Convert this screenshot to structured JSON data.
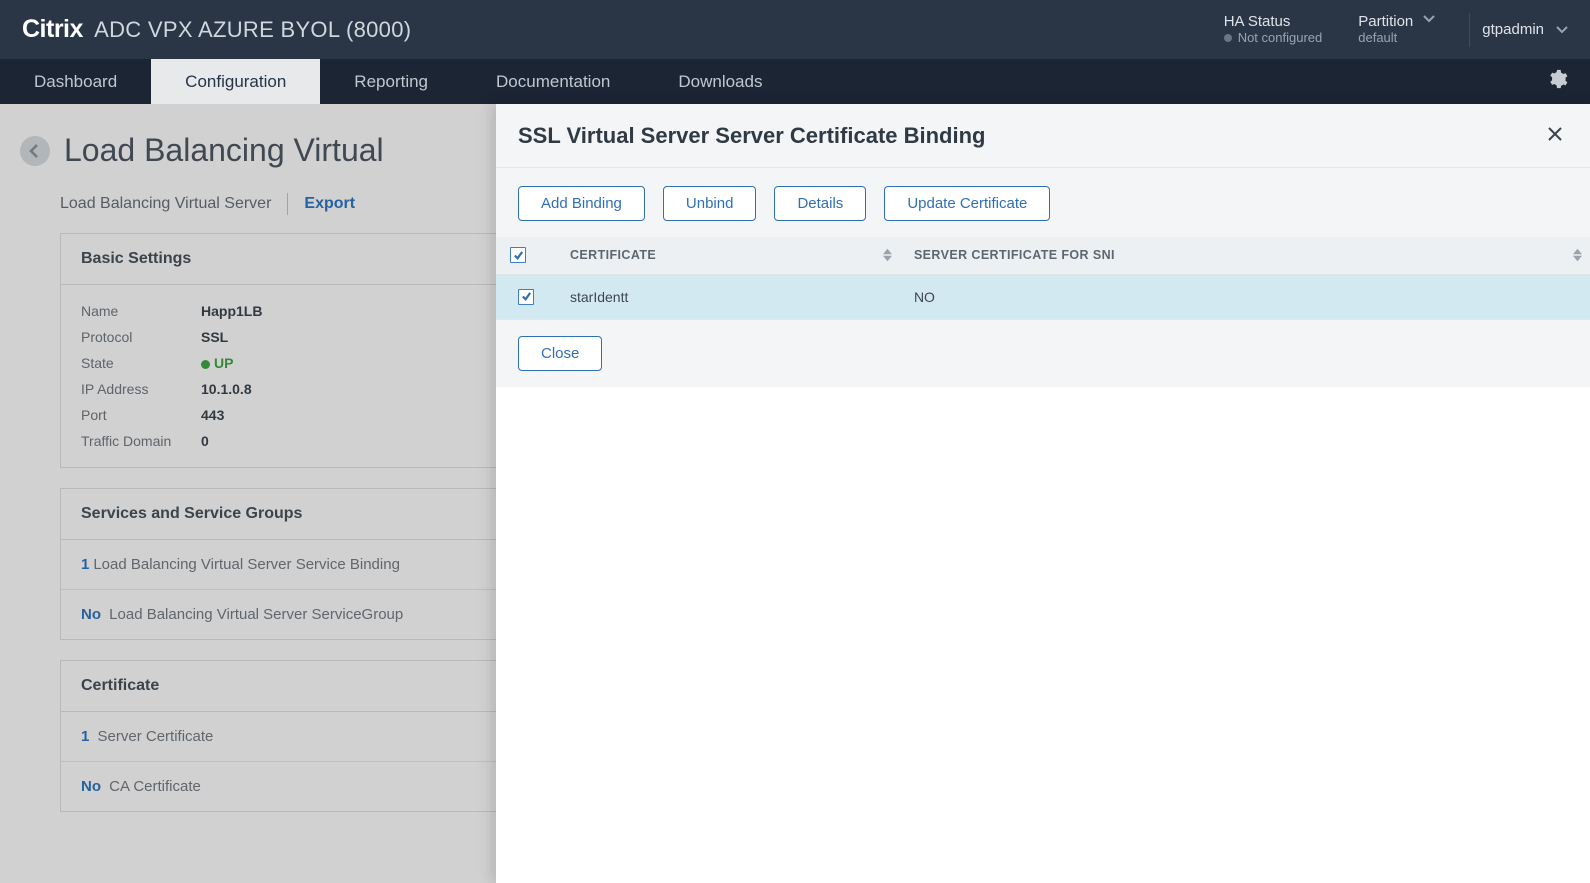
{
  "header": {
    "brand_strong": "Citrix",
    "brand_rest": "ADC VPX AZURE BYOL (8000)",
    "ha_label": "HA Status",
    "ha_value": "Not configured",
    "partition_label": "Partition",
    "partition_value": "default",
    "user": "gtpadmin"
  },
  "nav": {
    "dashboard": "Dashboard",
    "configuration": "Configuration",
    "reporting": "Reporting",
    "documentation": "Documentation",
    "downloads": "Downloads"
  },
  "page": {
    "title": "Load Balancing Virtual",
    "crumb": "Load Balancing Virtual Server",
    "export": "Export",
    "basic_settings_title": "Basic Settings",
    "fields": {
      "name_label": "Name",
      "name_value": "Happ1LB",
      "protocol_label": "Protocol",
      "protocol_value": "SSL",
      "state_label": "State",
      "state_value": "UP",
      "ip_label": "IP Address",
      "ip_value": "10.1.0.8",
      "port_label": "Port",
      "port_value": "443",
      "td_label": "Traffic Domain",
      "td_value": "0"
    },
    "services_title": "Services and Service Groups",
    "svc_binding_count": "1",
    "svc_binding_text": "Load Balancing Virtual Server Service Binding",
    "svc_grp_count": "No",
    "svc_grp_text": "Load Balancing Virtual Server ServiceGroup",
    "cert_title": "Certificate",
    "cert_server_count": "1",
    "cert_server_text": "Server Certificate",
    "cert_ca_count": "No",
    "cert_ca_text": "CA Certificate"
  },
  "slide": {
    "title": "SSL Virtual Server Server Certificate Binding",
    "buttons": {
      "add": "Add Binding",
      "unbind": "Unbind",
      "details": "Details",
      "update": "Update Certificate",
      "close": "Close"
    },
    "columns": {
      "cert": "CERTIFICATE",
      "sni": "SERVER CERTIFICATE FOR SNI"
    },
    "rows": [
      {
        "cert": "starIdentt",
        "sni": "NO",
        "checked": true
      }
    ]
  }
}
